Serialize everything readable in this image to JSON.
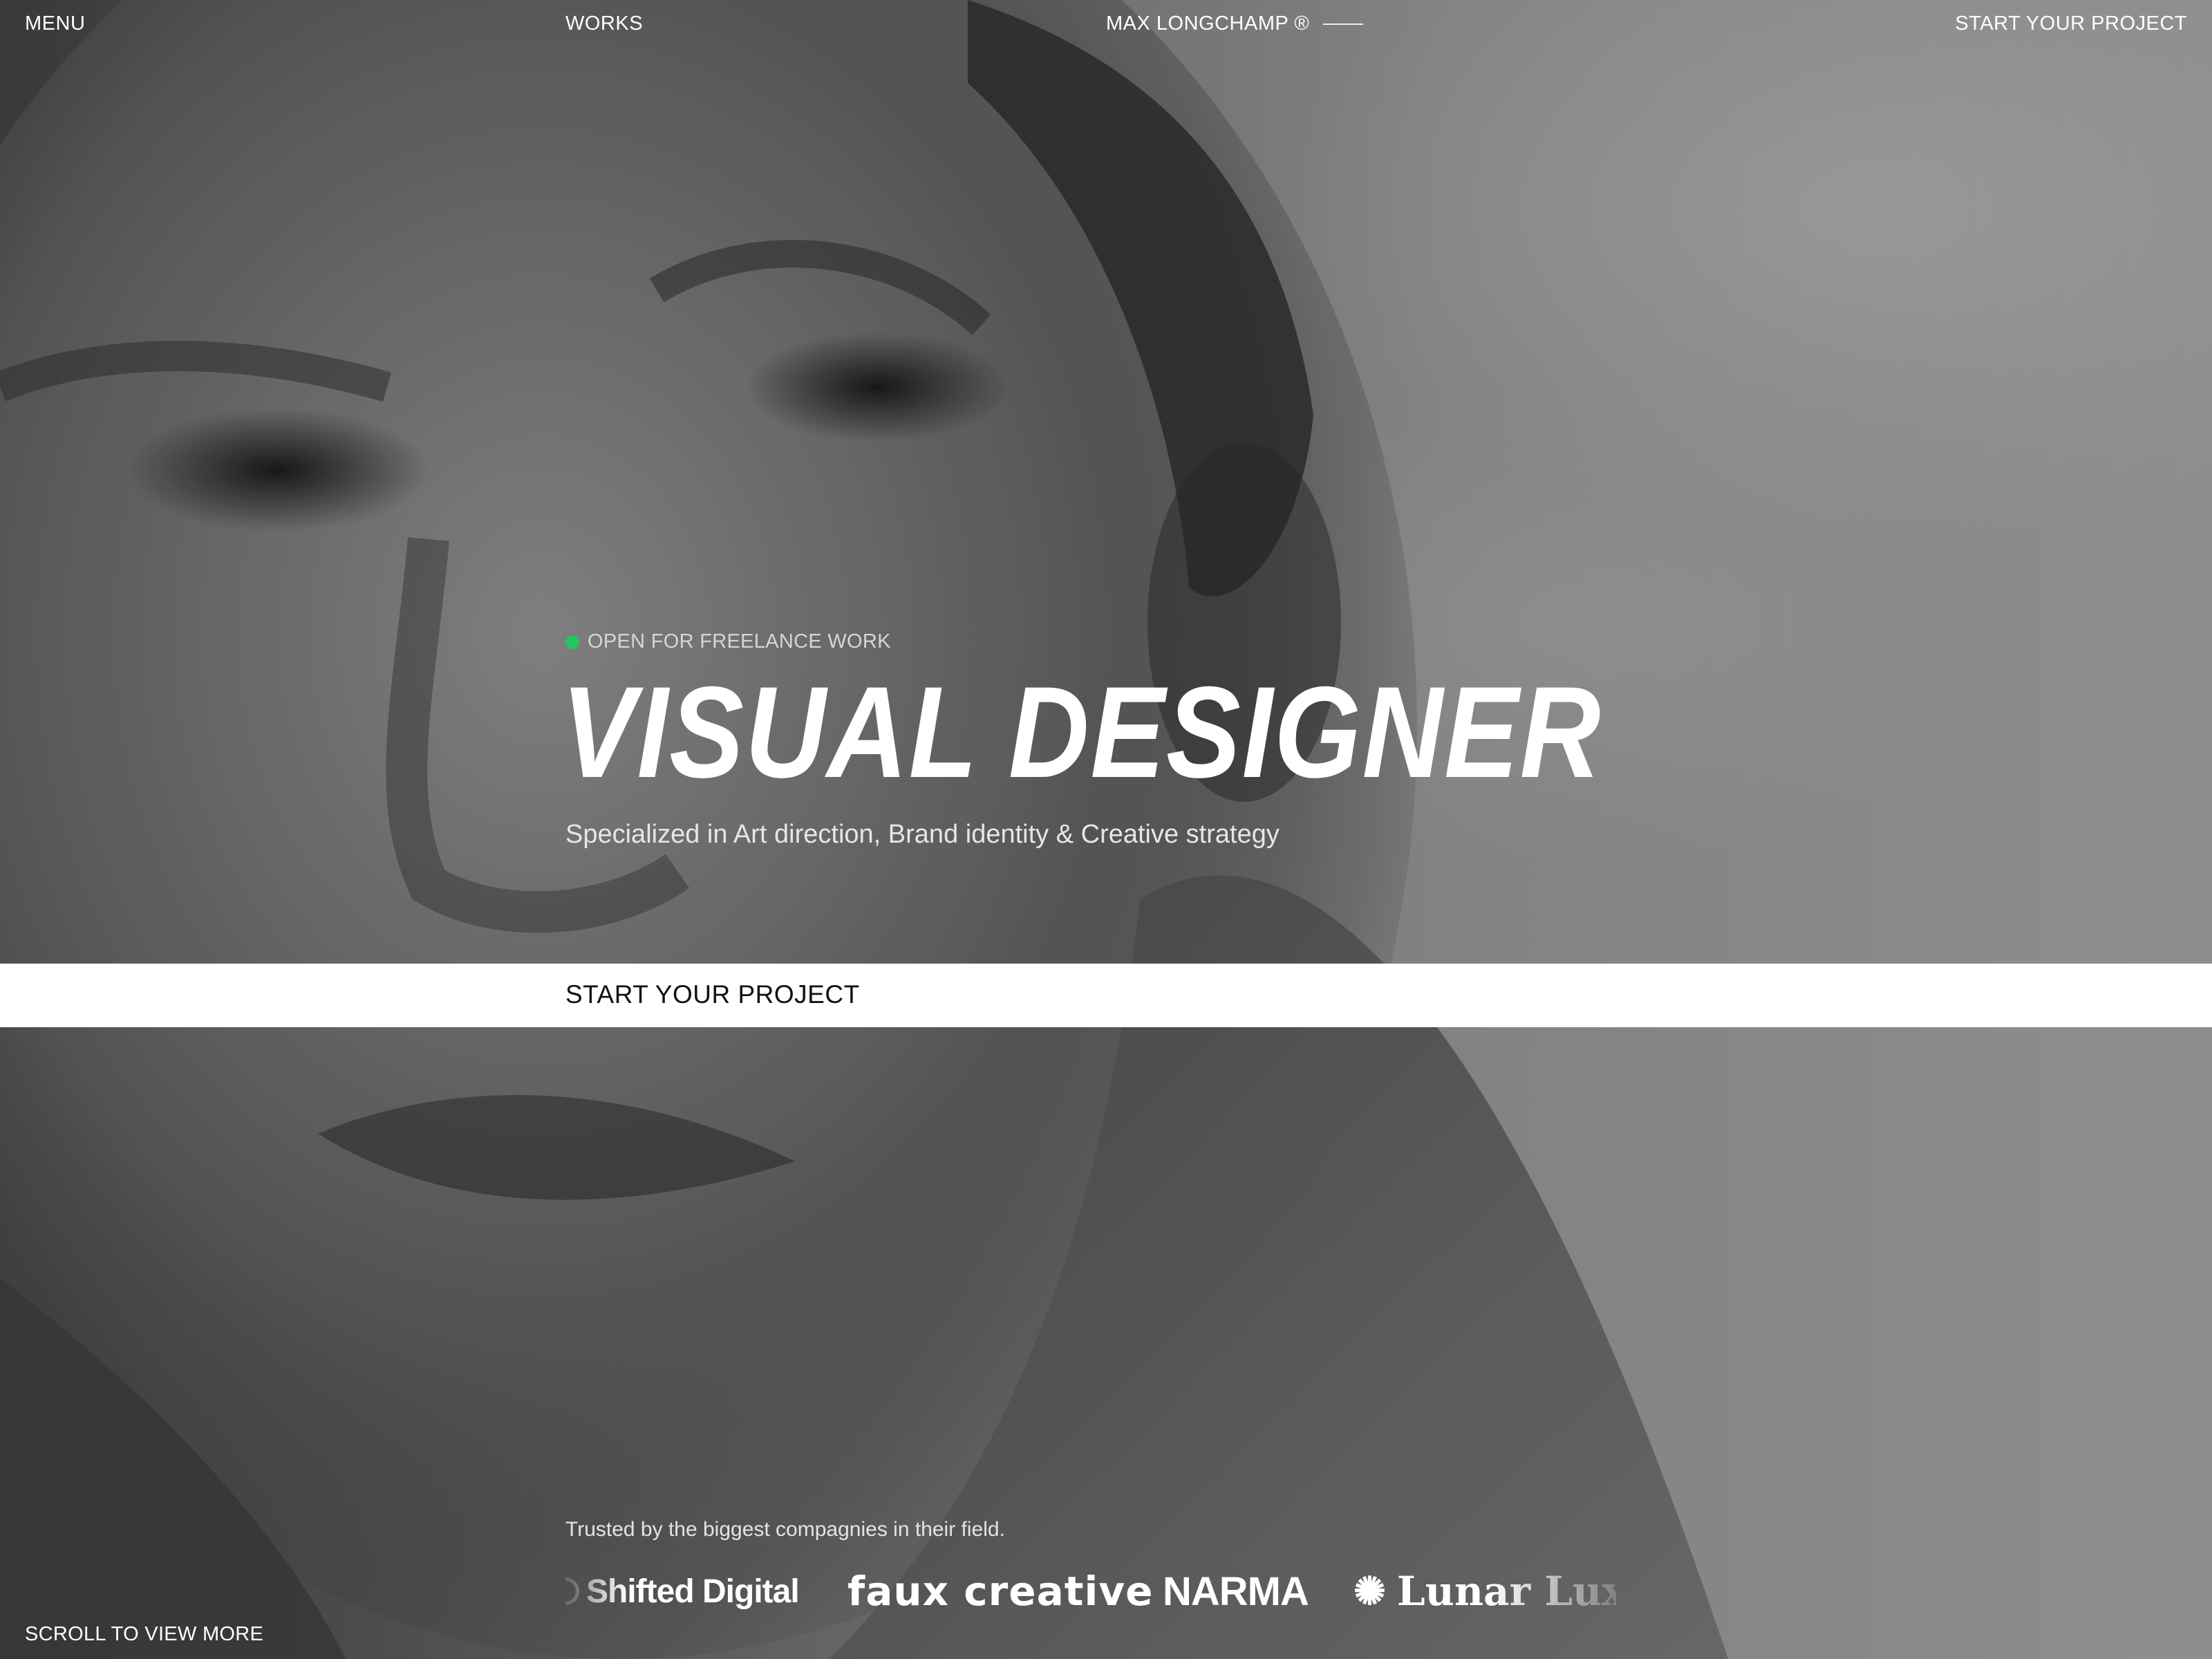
{
  "nav": {
    "menu_label": "MENU",
    "works_label": "WORKS",
    "brand_label": "MAX LONGCHAMP ®",
    "cta_label": "START YOUR PROJECT"
  },
  "hero": {
    "status_label": "OPEN FOR FREELANCE WORK",
    "status_color": "#22c55e",
    "title": "VISUAL DESIGNER",
    "subtitle": "Specialized in Art direction, Brand identity & Creative strategy",
    "cta_label": "START YOUR PROJECT"
  },
  "clients": {
    "intro": "Trusted by the biggest compagnies in their field.",
    "logos": [
      {
        "name": "Shifted Digital",
        "icon": "shifted-digital-mark"
      },
      {
        "name": "faux creative",
        "icon": ""
      },
      {
        "name": "NARMA",
        "icon": ""
      },
      {
        "name": "Lunar Luxe",
        "icon": "sunburst-icon"
      }
    ]
  },
  "footer": {
    "scroll_hint": "SCROLL TO VIEW MORE"
  },
  "colors": {
    "accent": "#22c55e",
    "cta_background": "#ffffff",
    "cta_text": "#111111",
    "text": "#ffffff"
  }
}
